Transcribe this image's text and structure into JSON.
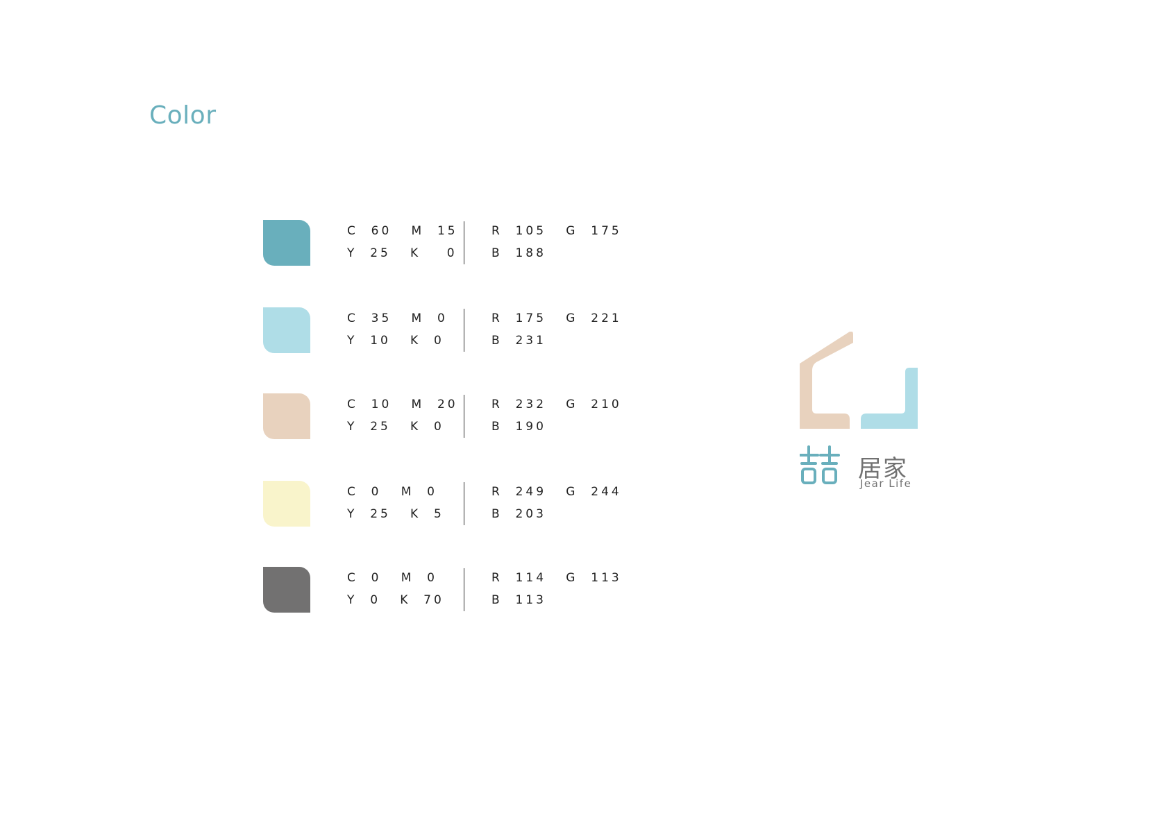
{
  "title": "Color",
  "swatches": [
    {
      "fill": "#69afbc",
      "cmyk_line1": "C  60   M  15",
      "cmyk_line2": "Y  25   K    0",
      "rgb_line1": "R  105   G  175",
      "rgb_line2": "B  188"
    },
    {
      "fill": "#afdde7",
      "cmyk_line1": "C  35   M  0",
      "cmyk_line2": "Y  10   K  0",
      "rgb_line1": "R  175   G  221",
      "rgb_line2": "B  231"
    },
    {
      "fill": "#e8d2be",
      "cmyk_line1": "C  10   M  20",
      "cmyk_line2": "Y  25   K  0",
      "rgb_line1": "R  232   G  210",
      "rgb_line2": "B  190"
    },
    {
      "fill": "#f9f4cb",
      "cmyk_line1": "C  0   M  0",
      "cmyk_line2": "Y  25   K  5",
      "rgb_line1": "R  249   G  244",
      "rgb_line2": "B  203"
    },
    {
      "fill": "#727171",
      "cmyk_line1": "C  0   M  0",
      "cmyk_line2": "Y  0   K  70",
      "rgb_line1": "R  114   G  113",
      "rgb_line2": "B  113"
    }
  ],
  "logo": {
    "mark_char": "喆",
    "name_cn": "居家",
    "name_en": "Jear Life",
    "colors": {
      "beige": "#e8d2be",
      "light_blue": "#afdde7",
      "teal": "#69afbc",
      "gray": "#717171"
    }
  }
}
